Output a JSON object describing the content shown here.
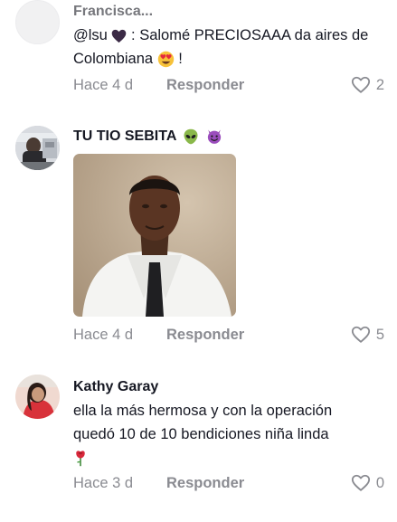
{
  "comments": [
    {
      "username": "Francisca...",
      "text_mention": "@lsu",
      "text_rest": ": Salomé PRECIOSAAA da aires de Colombiana",
      "text_end": "!",
      "time": "Hace 4 d",
      "reply": "Responder",
      "likes": "2"
    },
    {
      "username": "TU TIO SEBITA",
      "time": "Hace 4 d",
      "reply": "Responder",
      "likes": "5"
    },
    {
      "username": "Kathy Garay",
      "text": "ella la más hermosa y con la operación quedó 10 de 10 bendiciones niña linda",
      "time": "Hace 3 d",
      "reply": "Responder",
      "likes": "0"
    }
  ],
  "icons": {
    "heart": "heart-outline-icon",
    "dark_heart": "dark-heart-emoji",
    "heart_eyes": "heart-eyes-emoji",
    "alien": "alien-emoji",
    "devil": "smiling-devil-emoji",
    "rose": "rose-emoji"
  },
  "colors": {
    "text": "#161823",
    "muted": "#8a8b91",
    "background": "#ffffff"
  }
}
